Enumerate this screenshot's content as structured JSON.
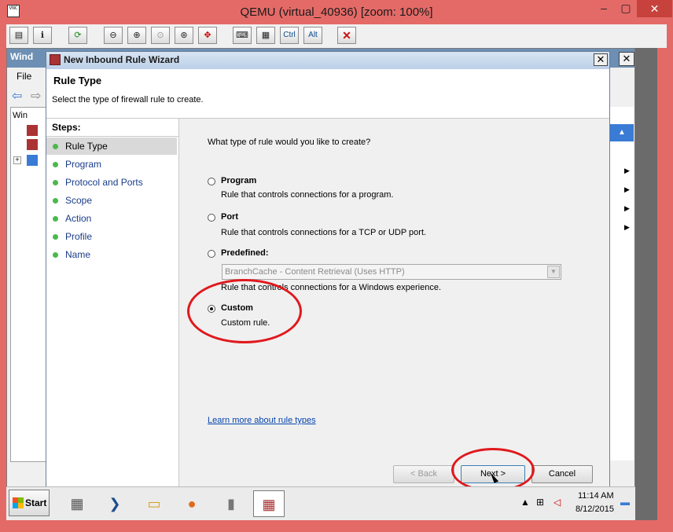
{
  "qemu": {
    "title": "QEMU (virtual_40936) [zoom: 100%]",
    "app_icon": "VNC",
    "min": "–",
    "max": "▢",
    "close": "✕",
    "toolbar": {
      "ctrl": "Ctrl",
      "alt": "Alt"
    }
  },
  "mmc": {
    "title": "Wind",
    "menu_file": "File",
    "tree_root": "Win"
  },
  "wizard": {
    "title": "New Inbound Rule Wizard",
    "close": "✕",
    "heading": "Rule Type",
    "subtitle": "Select the type of firewall rule to create.",
    "steps_title": "Steps:",
    "steps": [
      {
        "label": "Rule Type",
        "current": true
      },
      {
        "label": "Program"
      },
      {
        "label": "Protocol and Ports"
      },
      {
        "label": "Scope"
      },
      {
        "label": "Action"
      },
      {
        "label": "Profile"
      },
      {
        "label": "Name"
      }
    ],
    "question": "What type of rule would you like to create?",
    "options": [
      {
        "label": "Program",
        "desc": "Rule that controls connections for a program.",
        "checked": false
      },
      {
        "label": "Port",
        "desc": "Rule that controls connections for a TCP or UDP port.",
        "checked": false
      },
      {
        "label": "Predefined:",
        "desc": "Rule that controls connections for a Windows experience.",
        "checked": false
      },
      {
        "label": "Custom",
        "desc": "Custom rule.",
        "checked": true
      }
    ],
    "predefined_value": "BranchCache - Content Retrieval (Uses HTTP)",
    "learn_more": "Learn more about rule types",
    "back": "< Back",
    "next": "Next >",
    "cancel": "Cancel"
  },
  "annotation_color": "#e0191d",
  "taskbar": {
    "start": "Start",
    "time": "11:14 AM",
    "date": "8/12/2015"
  }
}
